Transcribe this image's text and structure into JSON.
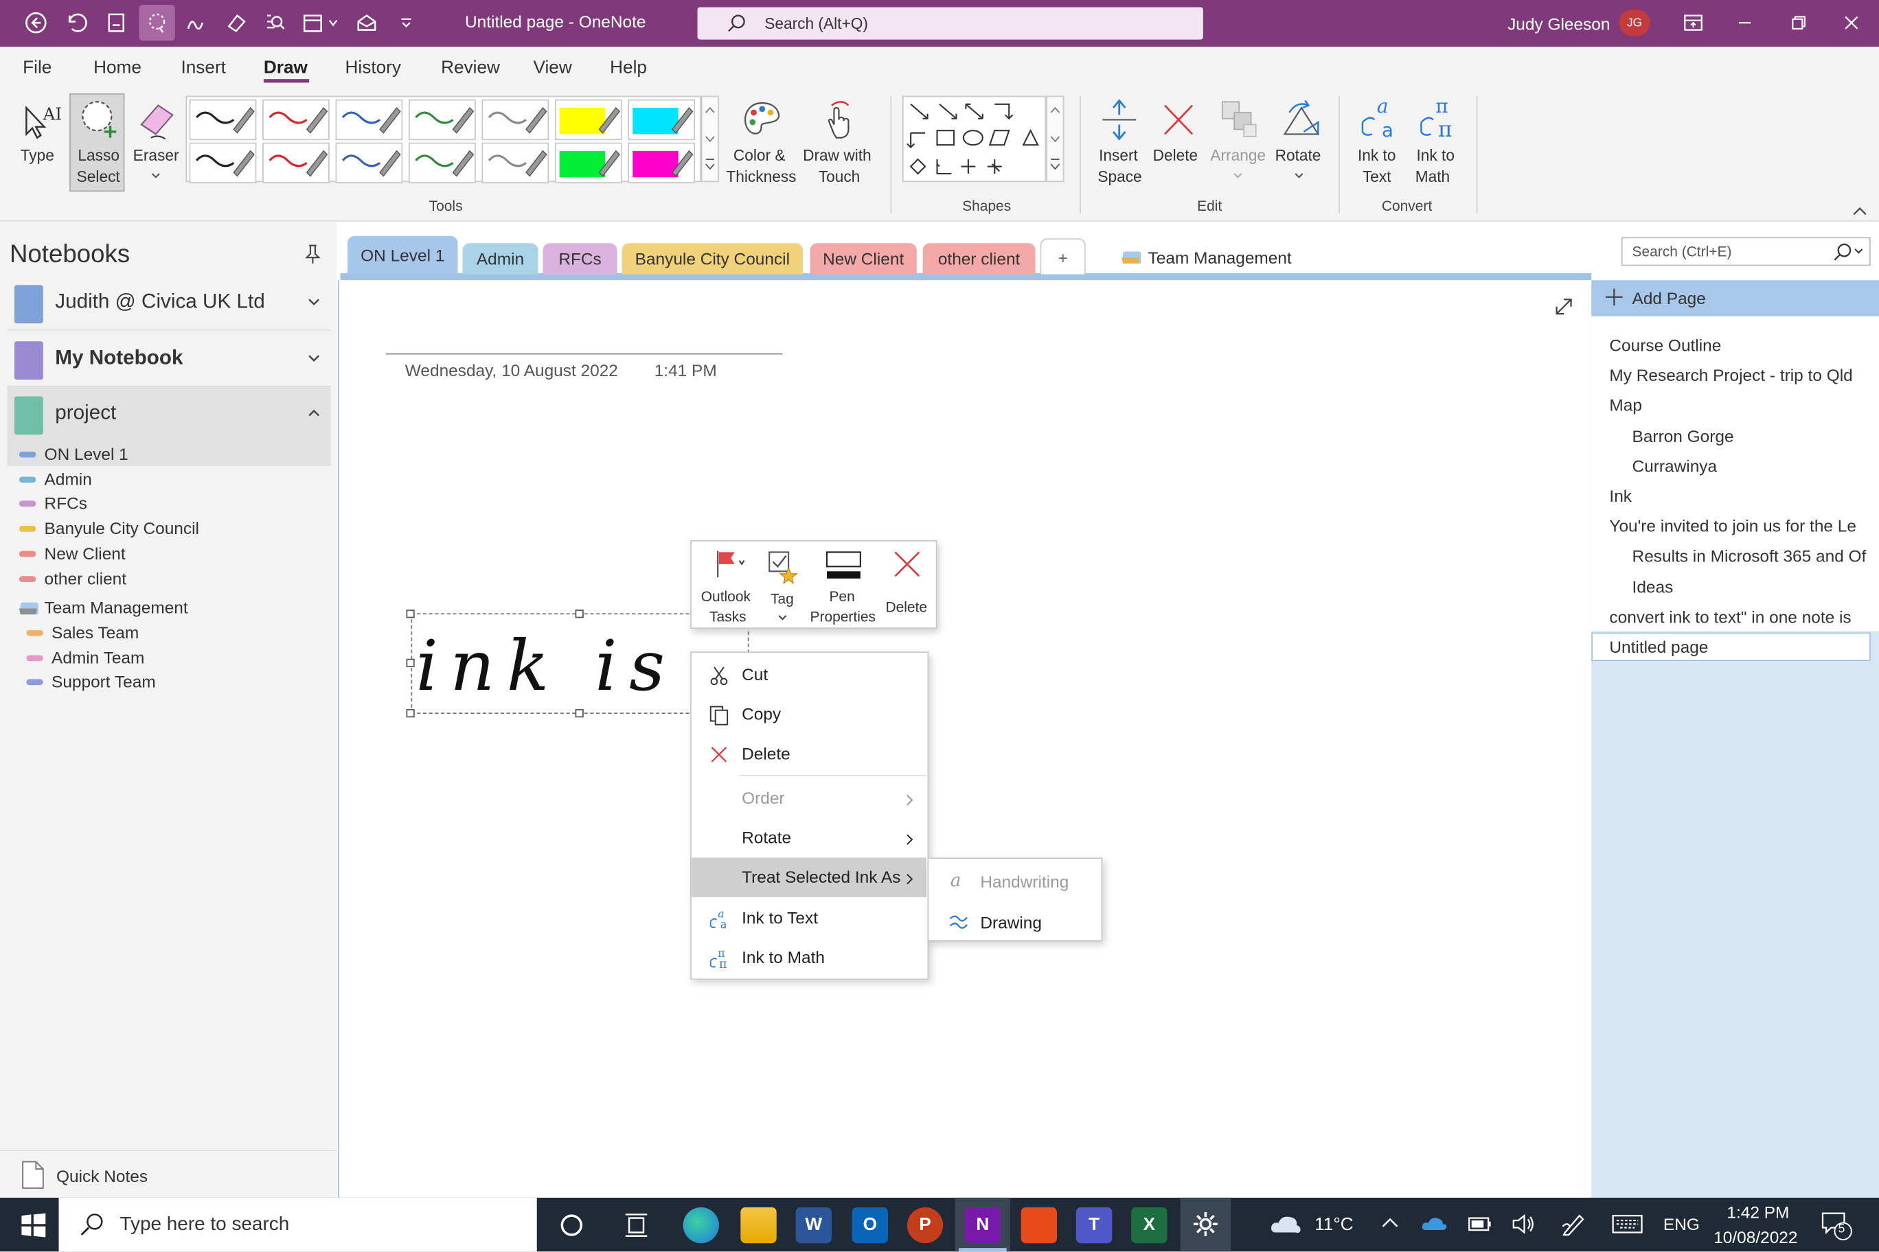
{
  "titlebar": {
    "doc_title": "Untitled page  -  OneNote",
    "search_placeholder": "Search (Alt+Q)",
    "user_name": "Judy Gleeson",
    "user_initials": "JG"
  },
  "menu": {
    "file": "File",
    "home": "Home",
    "insert": "Insert",
    "draw": "Draw",
    "history": "History",
    "review": "Review",
    "view": "View",
    "help": "Help"
  },
  "ribbon": {
    "type_label": "Type",
    "lasso_label_1": "Lasso",
    "lasso_label_2": "Select",
    "eraser_label": "Eraser",
    "color_thickness_1": "Color &",
    "color_thickness_2": "Thickness",
    "draw_touch_1": "Draw with",
    "draw_touch_2": "Touch",
    "tools_group": "Tools",
    "shapes_group": "Shapes",
    "insert_space_1": "Insert",
    "insert_space_2": "Space",
    "delete_label": "Delete",
    "arrange_label": "Arrange",
    "rotate_label": "Rotate",
    "edit_group": "Edit",
    "ink_to_text_1": "Ink to",
    "ink_to_text_2": "Text",
    "ink_to_math_1": "Ink to",
    "ink_to_math_2": "Math",
    "convert_group": "Convert",
    "pen_colors_row1": [
      "#222222",
      "#d32626",
      "#2f62b8",
      "#2f8a3c",
      "#8a8a8a",
      "#ffff00",
      "#00e5ff"
    ],
    "pen_colors_row2": [
      "#222222",
      "#d32626",
      "#2f62b8",
      "#2f8a3c",
      "#8a8a8a",
      "#00ee33",
      "#ff00cc"
    ]
  },
  "notebooks": {
    "title": "Notebooks",
    "books": [
      {
        "label": "Judith @ Civica UK Ltd",
        "color": "#7ea1d8"
      },
      {
        "label": "My Notebook",
        "color": "#9a8ad4"
      },
      {
        "label": "project",
        "color": "#6fc0a6"
      }
    ],
    "sections": [
      {
        "label": "ON Level 1",
        "color": "#7ea1d8"
      },
      {
        "label": "Admin",
        "color": "#74b6d6"
      },
      {
        "label": "RFCs",
        "color": "#c895cf"
      },
      {
        "label": "Banyule City Council",
        "color": "#e6c14e"
      },
      {
        "label": "New Client",
        "color": "#ef8a8a"
      },
      {
        "label": "other client",
        "color": "#ef8a8a"
      }
    ],
    "group": {
      "label": "Team Management"
    },
    "group_sections": [
      {
        "label": "Sales Team",
        "color": "#ecb36a"
      },
      {
        "label": "Admin Team",
        "color": "#e59ac4"
      },
      {
        "label": "Support Team",
        "color": "#8f9de0"
      }
    ],
    "quick_notes": "Quick Notes"
  },
  "tabs": [
    {
      "label": "ON Level 1",
      "color": "#a7c7ea"
    },
    {
      "label": "Admin",
      "color": "#a9d4e8"
    },
    {
      "label": "RFCs",
      "color": "#d9b3de"
    },
    {
      "label": "Banyule City Council",
      "color": "#f1d27a"
    },
    {
      "label": "New Client",
      "color": "#f5a8a8"
    },
    {
      "label": "other client",
      "color": "#f5a8a8"
    }
  ],
  "tab_plus": "+",
  "tab_group": "Team Management",
  "page": {
    "date": "Wednesday, 10 August 2022",
    "time": "1:41 PM",
    "ink_text": "ink is fu"
  },
  "pages_pane": {
    "search_placeholder": "Search (Ctrl+E)",
    "add_page": "Add Page",
    "pages": [
      {
        "label": "Course Outline",
        "level": 0
      },
      {
        "label": "My Research Project - trip to Qld",
        "level": 0
      },
      {
        "label": "Map",
        "level": 0
      },
      {
        "label": "Barron Gorge",
        "level": 1
      },
      {
        "label": "Currawinya",
        "level": 1
      },
      {
        "label": "Ink",
        "level": 0
      },
      {
        "label": "You're invited to join us for the Le",
        "level": 0
      },
      {
        "label": "Results in Microsoft 365 and Of",
        "level": 1
      },
      {
        "label": "Ideas",
        "level": 1
      },
      {
        "label": "convert ink to text\" in one note is",
        "level": 0
      },
      {
        "label": "Untitled page",
        "level": 0
      }
    ]
  },
  "mini_toolbar": {
    "outlook_1": "Outlook",
    "outlook_2": "Tasks",
    "tag": "Tag",
    "pen_props_1": "Pen",
    "pen_props_2": "Properties",
    "delete": "Delete"
  },
  "context_menu": {
    "cut": "Cut",
    "copy": "Copy",
    "delete": "Delete",
    "order": "Order",
    "rotate": "Rotate",
    "treat_as": "Treat Selected Ink As",
    "ink_to_text": "Ink to Text",
    "ink_to_math": "Ink to Math"
  },
  "submenu": {
    "handwriting": "Handwriting",
    "drawing": "Drawing"
  },
  "taskbar": {
    "search_placeholder": "Type here to search",
    "weather": "11°C",
    "language": "ENG",
    "time": "1:42 PM",
    "date": "10/08/2022",
    "notifications": "5"
  }
}
